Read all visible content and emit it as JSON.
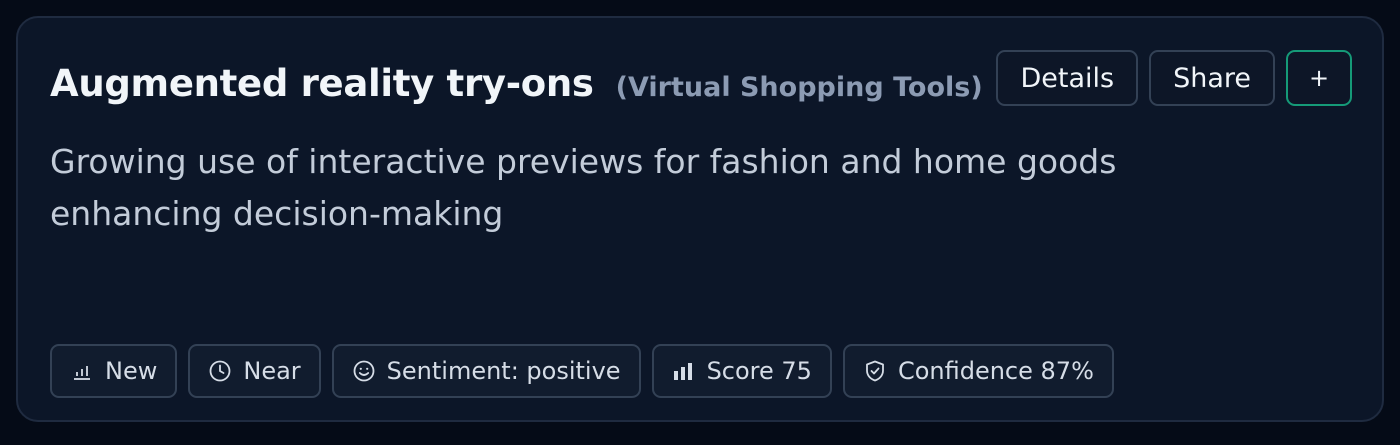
{
  "card": {
    "title": "Augmented reality try-ons",
    "category": "(Virtual Shopping Tools)",
    "description": "Growing use of interactive previews for fashion and home goods enhancing decision-making"
  },
  "actions": {
    "details_label": "Details",
    "share_label": "Share",
    "add_label": "+"
  },
  "chips": {
    "status": {
      "label": "New",
      "icon": "bar-chart-icon"
    },
    "horizon": {
      "label": "Near",
      "icon": "clock-icon"
    },
    "sentiment": {
      "label": "Sentiment: positive",
      "icon": "smile-icon"
    },
    "score": {
      "label": "Score 75",
      "icon": "signal-bars-icon"
    },
    "confidence": {
      "label": "Confidence 87%",
      "icon": "shield-check-icon"
    }
  },
  "colors": {
    "background": "#050b17",
    "card": "#0c1628",
    "border": "#1f2b40",
    "accent": "#159a78",
    "title": "#f1f5f9",
    "muted": "#8c9bb3"
  }
}
